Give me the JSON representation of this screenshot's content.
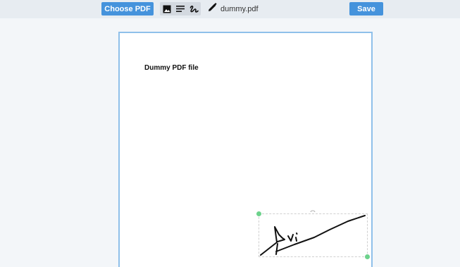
{
  "toolbar": {
    "choose_label": "Choose PDF",
    "save_label": "Save",
    "tools": [
      {
        "icon": "image-icon"
      },
      {
        "icon": "text-icon"
      },
      {
        "icon": "draw-signature-icon"
      }
    ],
    "filename_icon": "pencil-icon",
    "filename": "dummy.pdf"
  },
  "document": {
    "title": "Dummy PDF file"
  },
  "colors": {
    "accent": "#4593dc",
    "page_border": "#8fc0ea",
    "handle": "#6dd28c",
    "toolbar_bg": "#e7ecf1"
  }
}
